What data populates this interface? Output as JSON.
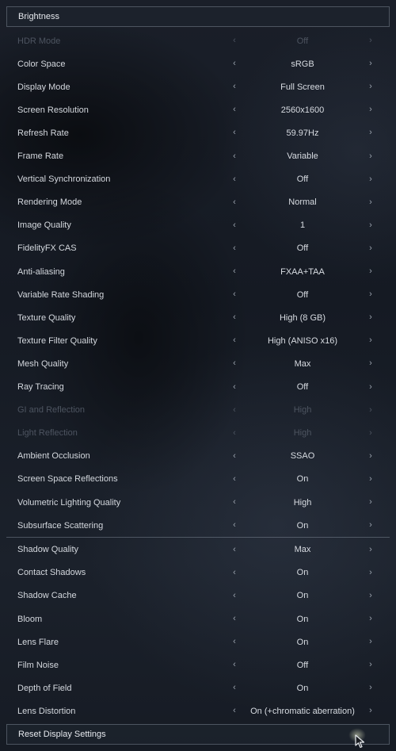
{
  "header": {
    "label": "Brightness"
  },
  "glyphs": {
    "left": "‹",
    "right": "›"
  },
  "settings": [
    {
      "label": "HDR Mode",
      "value": "Off",
      "disabled": true
    },
    {
      "label": "Color Space",
      "value": "sRGB"
    },
    {
      "label": "Display Mode",
      "value": "Full Screen"
    },
    {
      "label": "Screen Resolution",
      "value": "2560x1600"
    },
    {
      "label": "Refresh Rate",
      "value": "59.97Hz"
    },
    {
      "label": "Frame Rate",
      "value": "Variable"
    },
    {
      "label": "Vertical Synchronization",
      "value": "Off"
    },
    {
      "label": "Rendering Mode",
      "value": "Normal"
    },
    {
      "label": "Image Quality",
      "value": "1"
    },
    {
      "label": "FidelityFX CAS",
      "value": "Off"
    },
    {
      "label": "Anti-aliasing",
      "value": "FXAA+TAA"
    },
    {
      "label": "Variable Rate Shading",
      "value": "Off"
    },
    {
      "label": "Texture Quality",
      "value": "High (8 GB)"
    },
    {
      "label": "Texture Filter Quality",
      "value": "High (ANISO x16)"
    },
    {
      "label": "Mesh Quality",
      "value": "Max"
    },
    {
      "label": "Ray Tracing",
      "value": "Off"
    },
    {
      "label": "GI and Reflection",
      "value": "High",
      "disabled": true
    },
    {
      "label": "Light Reflection",
      "value": "High",
      "disabled": true
    },
    {
      "label": "Ambient Occlusion",
      "value": "SSAO"
    },
    {
      "label": "Screen Space Reflections",
      "value": "On"
    },
    {
      "label": "Volumetric Lighting Quality",
      "value": "High"
    },
    {
      "label": "Subsurface Scattering",
      "value": "On"
    },
    {
      "label": "Shadow Quality",
      "value": "Max"
    },
    {
      "label": "Contact Shadows",
      "value": "On"
    },
    {
      "label": "Shadow Cache",
      "value": "On"
    },
    {
      "label": "Bloom",
      "value": "On"
    },
    {
      "label": "Lens Flare",
      "value": "On"
    },
    {
      "label": "Film Noise",
      "value": "Off"
    },
    {
      "label": "Depth of Field",
      "value": "On"
    },
    {
      "label": "Lens Distortion",
      "value": "On (+chromatic aberration)"
    }
  ],
  "footer": {
    "label": "Reset Display Settings"
  },
  "colors": {
    "text": "#d4d8de",
    "disabled_text": "#4d5460",
    "border": "#aab4c3"
  }
}
